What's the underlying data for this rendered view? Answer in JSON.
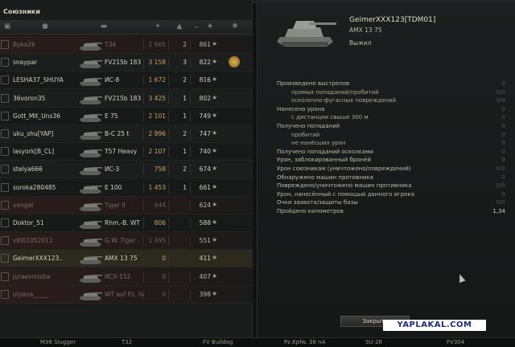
{
  "left_panel": {
    "title": "Союзники",
    "rows": [
      {
        "name": "Byka26",
        "tank": "T34",
        "damage": "1 965",
        "kills": "2",
        "xp": "861",
        "dead": true
      },
      {
        "name": "snaypar",
        "tank": "FV215b 183",
        "damage": "3 158",
        "kills": "3",
        "xp": "822",
        "dead": false,
        "medal": true
      },
      {
        "name": "LESHA37_SHUYA",
        "tank": "ИС-8",
        "damage": "1 672",
        "kills": "2",
        "xp": "816",
        "dead": false
      },
      {
        "name": "36voron35",
        "tank": "FV215b 183",
        "damage": "3 425",
        "kills": "1",
        "xp": "802",
        "dead": false
      },
      {
        "name": "Gott_Mit_Uns36",
        "tank": "E 75",
        "damage": "2 101",
        "kills": "1",
        "xp": "749",
        "dead": false
      },
      {
        "name": "uku_shu[YAP]",
        "tank": "B-C 25 t",
        "damage": "2 996",
        "kills": "2",
        "xp": "747",
        "dead": false,
        "platoon": true
      },
      {
        "name": "lasyork[B_CL]",
        "tank": "T57 Heavy",
        "damage": "2 107",
        "kills": "1",
        "xp": "740",
        "dead": false
      },
      {
        "name": "stelya666",
        "tank": "ИС-3",
        "damage": "758",
        "kills": "2",
        "xp": "674",
        "dead": false
      },
      {
        "name": "soroka280485",
        "tank": "E 100",
        "damage": "1 453",
        "kills": "1",
        "xp": "661",
        "dead": false
      },
      {
        "name": "vengel",
        "tank": "Tiger II",
        "damage": "644",
        "kills": "",
        "xp": "624",
        "dead": true
      },
      {
        "name": "Doktor_51",
        "tank": "Rhm.-B. WT",
        "damage": "806",
        "kills": "",
        "xp": "588",
        "dead": false
      },
      {
        "name": "vitl01052011",
        "tank": "G.W. Tiger",
        "damage": "1 495",
        "kills": "",
        "xp": "551",
        "dead": true
      },
      {
        "name": "GeimerXXX123..",
        "tank": "AMX 13 75",
        "damage": "0",
        "kills": "",
        "xp": "411",
        "dead": false,
        "selected": true
      },
      {
        "name": "juraevmisha",
        "tank": "ИСУ-152",
        "damage": "0",
        "kills": "",
        "xp": "407",
        "dead": true
      },
      {
        "name": "ulyana_____",
        "tank": "WT auf Pz. IV",
        "damage": "0",
        "kills": "",
        "xp": "398",
        "dead": true
      }
    ]
  },
  "right_panel": {
    "player_name": "GeimerXXX123[TDM01]",
    "player_tank": "AMX 13 75",
    "status": "Выжил",
    "stats": [
      {
        "label": "Произведено выстрелов",
        "value": "0",
        "indent": 1
      },
      {
        "label": "прямых попаданий/пробитий",
        "value": "0/0",
        "indent": 2
      },
      {
        "label": "осколочно-фугасных повреждений",
        "value": "0/0",
        "indent": 2
      },
      {
        "label": "Нанесено урона",
        "value": "0",
        "indent": 1
      },
      {
        "label": "с дистанции свыше 300 м",
        "value": "0",
        "indent": 2
      },
      {
        "label": "Получено попаданий",
        "value": "0",
        "indent": 1
      },
      {
        "label": "пробитий",
        "value": "0",
        "indent": 2
      },
      {
        "label": "не нанёсших урон",
        "value": "0",
        "indent": 2
      },
      {
        "label": "Получено попаданий осколками",
        "value": "0",
        "indent": 1
      },
      {
        "label": "Урон, заблокированный бронёй",
        "value": "0",
        "indent": 1
      },
      {
        "label": "Урон союзникам (уничтожено/повреждений)",
        "value": "0/0",
        "indent": 1
      },
      {
        "label": "Обнаружено машин противника",
        "value": "0",
        "indent": 1
      },
      {
        "label": "Повреждено/уничтожено машин противника",
        "value": "0/0",
        "indent": 1
      },
      {
        "label": "Урон, нанесённый с помощью данного игрока",
        "value": "0",
        "indent": 1
      },
      {
        "label": "Очки захвата/защиты базы",
        "value": "0/0",
        "indent": 1
      },
      {
        "label": "Пройдено километров",
        "value": "1,34",
        "indent": 1,
        "highlight": true
      }
    ],
    "close_label": "Закрыть"
  },
  "watermark": "YAPLAKAL.COM",
  "bottom_bar": [
    "M36 Slugger",
    "T32",
    "FV Bulldog",
    "Pz.Kpfw. 38 nA",
    "SU-26",
    "FV304"
  ]
}
